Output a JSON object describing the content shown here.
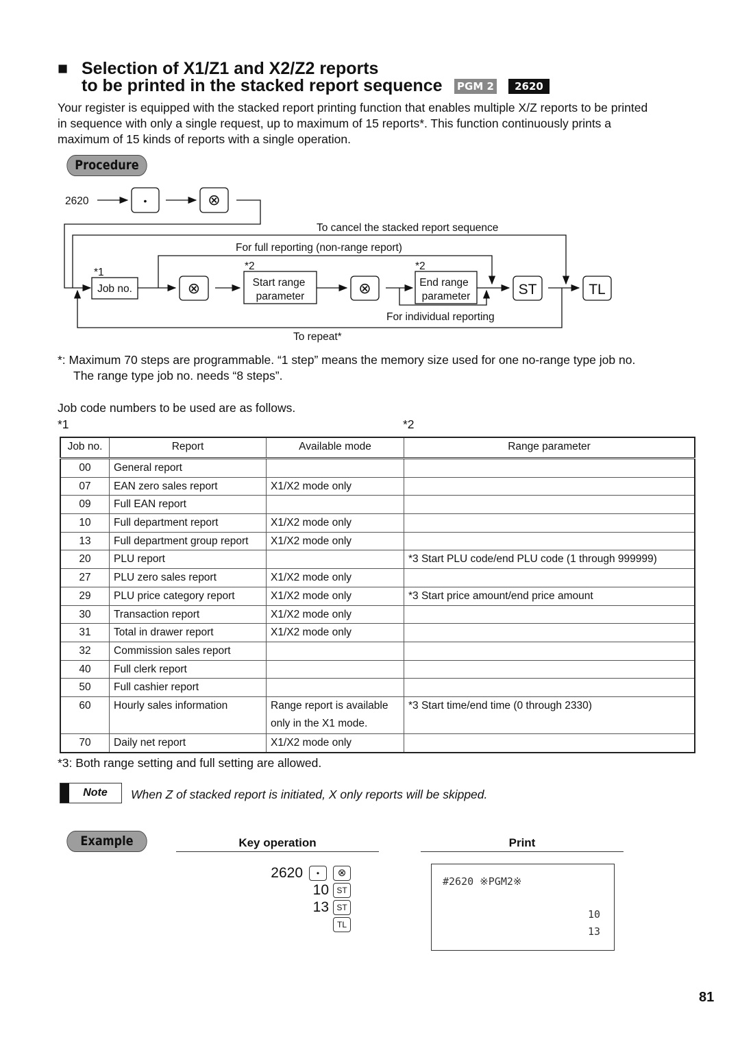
{
  "heading": {
    "bullet": "■",
    "line1": "Selection of X1/Z1 and X2/Z2 reports",
    "line2": "to be printed in the stacked report sequence",
    "badge_mode": "PGM 2",
    "badge_code": "2620"
  },
  "intro": [
    "Your register is equipped with the stacked report printing function that enables multiple X/Z reports to be printed",
    "in sequence with only a single request, up to maximum of 15 reports*.  This function continuously prints a",
    "maximum of 15 kinds of reports with a single operation."
  ],
  "procedure_label": "Procedure",
  "diagram": {
    "start_code": "2620",
    "dot_key": "•",
    "mult_key": "⊗",
    "cancel_label": "To cancel the stacked report sequence",
    "full_label": "For full reporting (non-range report)",
    "note1": "*1",
    "note2a": "*2",
    "note2b": "*2",
    "job_no": "Job no.",
    "start_range_1": "Start range",
    "start_range_2": "parameter",
    "end_range_1": "End range",
    "end_range_2": "parameter",
    "st_key": "ST",
    "tl_key": "TL",
    "individual_label": "For individual reporting",
    "repeat_label": "To repeat*"
  },
  "footnote_star": [
    "*:  Maximum 70 steps are programmable.  “1 step” means the memory size used for one no-range type job no.",
    "The range type job no. needs “8 steps”."
  ],
  "job_code_intro": "Job code numbers to be used are as follows.",
  "table_note1": "*1",
  "table_note2": "*2",
  "table": {
    "headers": [
      "Job no.",
      "Report",
      "Available mode",
      "Range parameter"
    ],
    "rows": [
      [
        "00",
        "General report",
        "",
        ""
      ],
      [
        "07",
        "EAN zero sales report",
        "X1/X2 mode only",
        ""
      ],
      [
        "09",
        "Full EAN report",
        "",
        ""
      ],
      [
        "10",
        "Full department report",
        "X1/X2 mode only",
        ""
      ],
      [
        "13",
        "Full department group report",
        "X1/X2 mode only",
        ""
      ],
      [
        "20",
        "PLU report",
        "",
        "*3 Start PLU code/end PLU code (1 through 999999)"
      ],
      [
        "27",
        "PLU zero sales report",
        "X1/X2 mode only",
        ""
      ],
      [
        "29",
        "PLU price category report",
        "X1/X2 mode only",
        "*3 Start price amount/end price amount"
      ],
      [
        "30",
        "Transaction report",
        "X1/X2 mode only",
        ""
      ],
      [
        "31",
        "Total in drawer report",
        "X1/X2 mode only",
        ""
      ],
      [
        "32",
        "Commission sales report",
        "",
        ""
      ],
      [
        "40",
        "Full clerk report",
        "",
        ""
      ],
      [
        "50",
        "Full cashier report",
        "",
        ""
      ],
      [
        "60",
        "Hourly sales information",
        "Range report is available only in the X1 mode.",
        "*3 Start time/end time (0 through 2330)"
      ],
      [
        "70",
        "Daily net report",
        "X1/X2 mode only",
        ""
      ]
    ]
  },
  "footnote3": "*3:  Both range setting and full setting are allowed.",
  "note": {
    "label": "Note",
    "text": "When Z of stacked report is initiated, X only reports will be skipped."
  },
  "example": {
    "label": "Example",
    "key_operation_header": "Key operation",
    "print_header": "Print",
    "keys": [
      {
        "num": "2620",
        "keys": [
          "•",
          "⊗"
        ]
      },
      {
        "num": "10",
        "keys": [
          "ST"
        ]
      },
      {
        "num": "13",
        "keys": [
          "ST"
        ]
      },
      {
        "num": "",
        "keys": [
          "TL"
        ]
      }
    ],
    "receipt": {
      "header": "#2620 ※PGM2※",
      "lines": [
        "10",
        "13"
      ]
    }
  },
  "page_number": "81"
}
